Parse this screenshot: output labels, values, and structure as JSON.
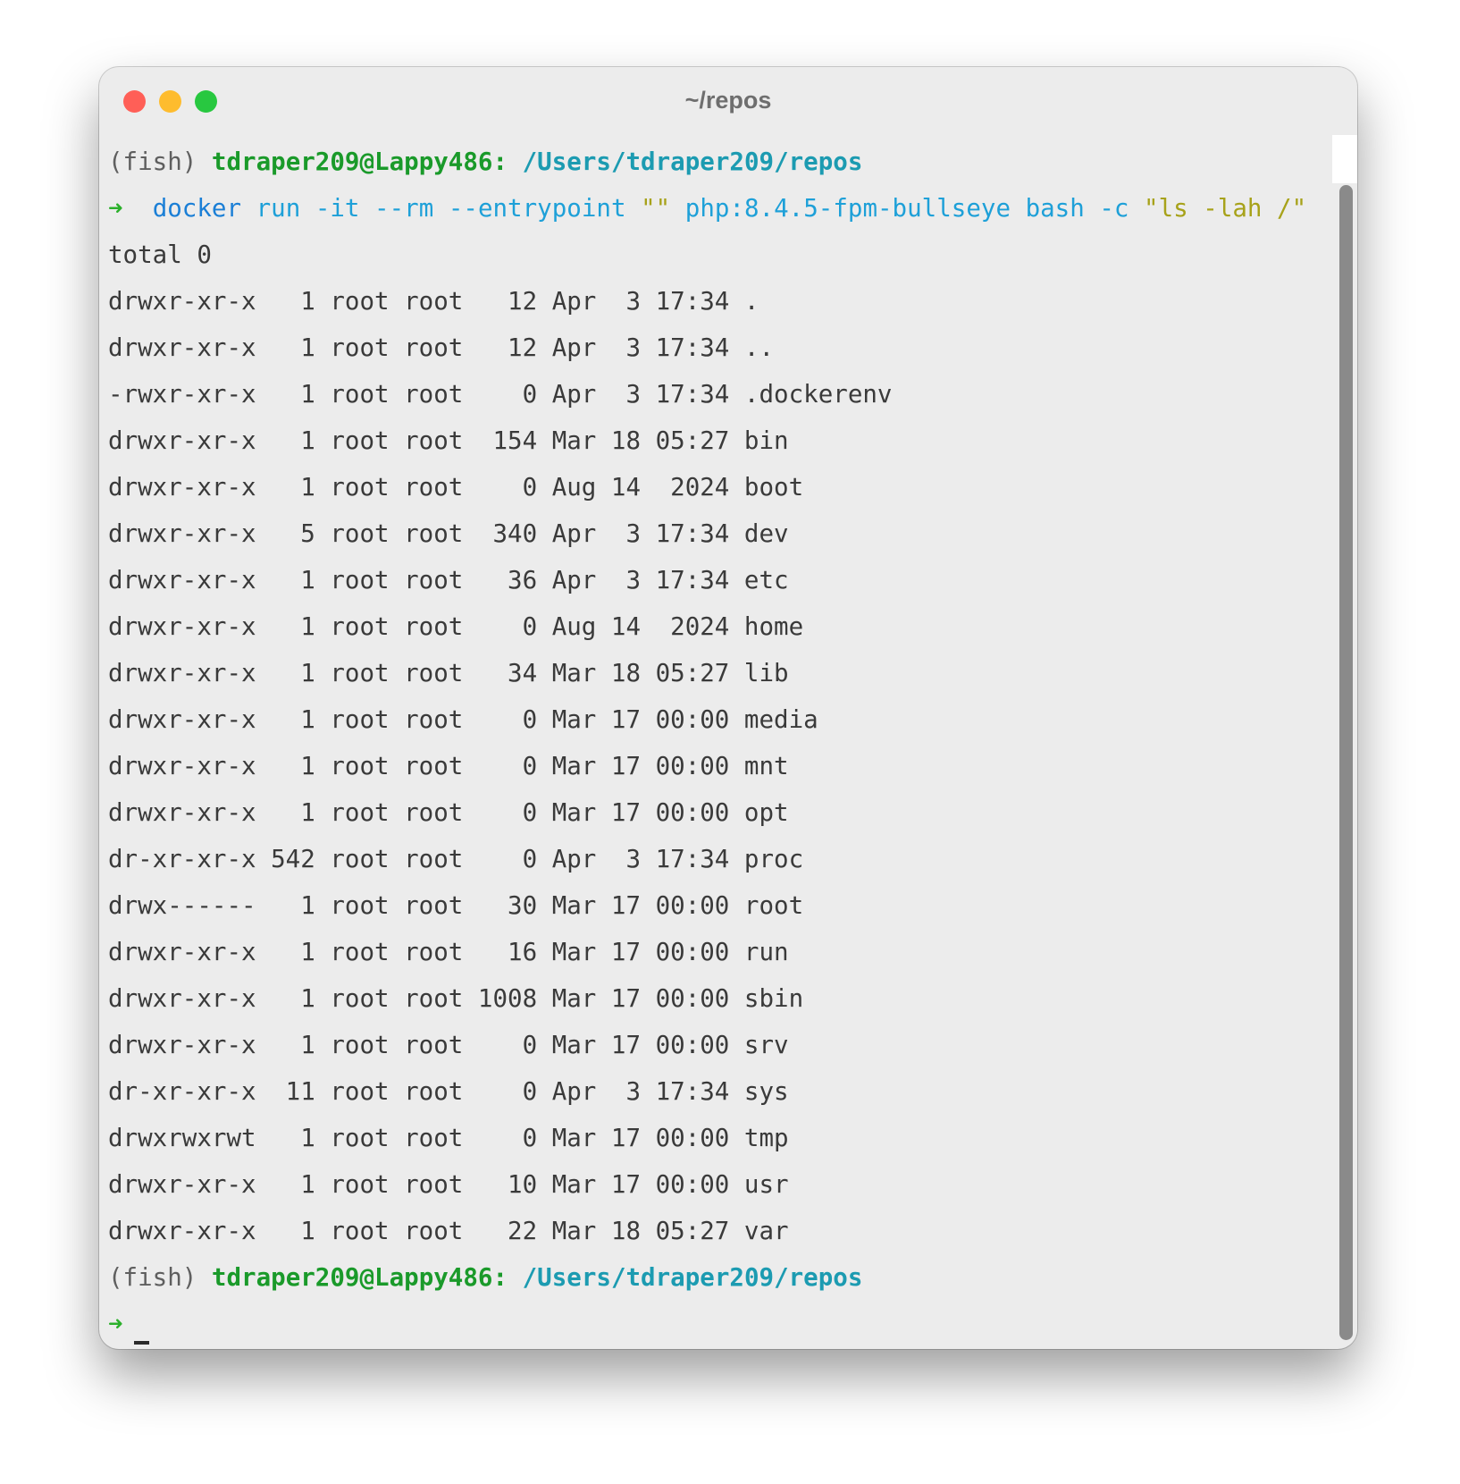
{
  "window": {
    "title": "~/repos"
  },
  "colors": {
    "close": "#ff5f57",
    "minimize": "#febc2e",
    "maximize": "#28c840",
    "prompt_user": "#1a9a2a",
    "prompt_path": "#1c9bb1",
    "prompt_arrow": "#2bb02b",
    "cmd_docker": "#1b7fd6",
    "cmd_args": "#1ea0d8",
    "cmd_string": "#a7a21a"
  },
  "prompt1": {
    "shell": "(fish)",
    "user": "tdraper209@Lappy486:",
    "path": "/Users/tdraper209/repos"
  },
  "command": {
    "arrow": "➜",
    "docker": "docker",
    "args": "run -it --rm --entrypoint",
    "empty_string": "\"\"",
    "image": "php:8.4.5-fpm-bullseye bash -c",
    "quoted": "\"ls -lah /\""
  },
  "output": [
    "total 0",
    "drwxr-xr-x   1 root root   12 Apr  3 17:34 .",
    "drwxr-xr-x   1 root root   12 Apr  3 17:34 ..",
    "-rwxr-xr-x   1 root root    0 Apr  3 17:34 .dockerenv",
    "drwxr-xr-x   1 root root  154 Mar 18 05:27 bin",
    "drwxr-xr-x   1 root root    0 Aug 14  2024 boot",
    "drwxr-xr-x   5 root root  340 Apr  3 17:34 dev",
    "drwxr-xr-x   1 root root   36 Apr  3 17:34 etc",
    "drwxr-xr-x   1 root root    0 Aug 14  2024 home",
    "drwxr-xr-x   1 root root   34 Mar 18 05:27 lib",
    "drwxr-xr-x   1 root root    0 Mar 17 00:00 media",
    "drwxr-xr-x   1 root root    0 Mar 17 00:00 mnt",
    "drwxr-xr-x   1 root root    0 Mar 17 00:00 opt",
    "dr-xr-xr-x 542 root root    0 Apr  3 17:34 proc",
    "drwx------   1 root root   30 Mar 17 00:00 root",
    "drwxr-xr-x   1 root root   16 Mar 17 00:00 run",
    "drwxr-xr-x   1 root root 1008 Mar 17 00:00 sbin",
    "drwxr-xr-x   1 root root    0 Mar 17 00:00 srv",
    "dr-xr-xr-x  11 root root    0 Apr  3 17:34 sys",
    "drwxrwxrwt   1 root root    0 Mar 17 00:00 tmp",
    "drwxr-xr-x   1 root root   10 Mar 17 00:00 usr",
    "drwxr-xr-x   1 root root   22 Mar 18 05:27 var"
  ],
  "prompt2": {
    "shell": "(fish)",
    "user": "tdraper209@Lappy486:",
    "path": "/Users/tdraper209/repos",
    "arrow": "➜"
  }
}
